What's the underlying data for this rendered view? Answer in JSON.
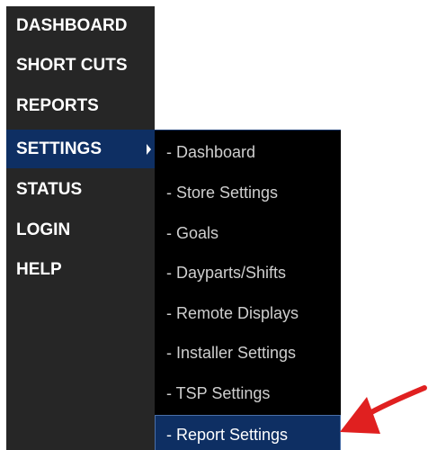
{
  "main_menu": {
    "items": [
      {
        "label": "DASHBOARD"
      },
      {
        "label": "SHORT CUTS"
      },
      {
        "label": "REPORTS"
      },
      {
        "label": "SETTINGS",
        "active": true,
        "has_submenu": true
      },
      {
        "label": "STATUS"
      },
      {
        "label": "LOGIN"
      },
      {
        "label": "HELP"
      }
    ]
  },
  "settings_submenu": {
    "items": [
      {
        "label": "- Dashboard"
      },
      {
        "label": "- Store Settings"
      },
      {
        "label": "- Goals"
      },
      {
        "label": "- Dayparts/Shifts"
      },
      {
        "label": "- Remote Displays"
      },
      {
        "label": "- Installer Settings"
      },
      {
        "label": "- TSP Settings"
      },
      {
        "label": "- Report Settings",
        "highlighted": true
      }
    ]
  },
  "annotation": {
    "icon": "red-pointer-arrow-icon",
    "color": "#e02020"
  },
  "colors": {
    "menu_bg": "#262626",
    "submenu_bg": "#000000",
    "active_bg": "#0e2f63",
    "text": "#ffffff",
    "submenu_text": "#cfcfcf"
  }
}
